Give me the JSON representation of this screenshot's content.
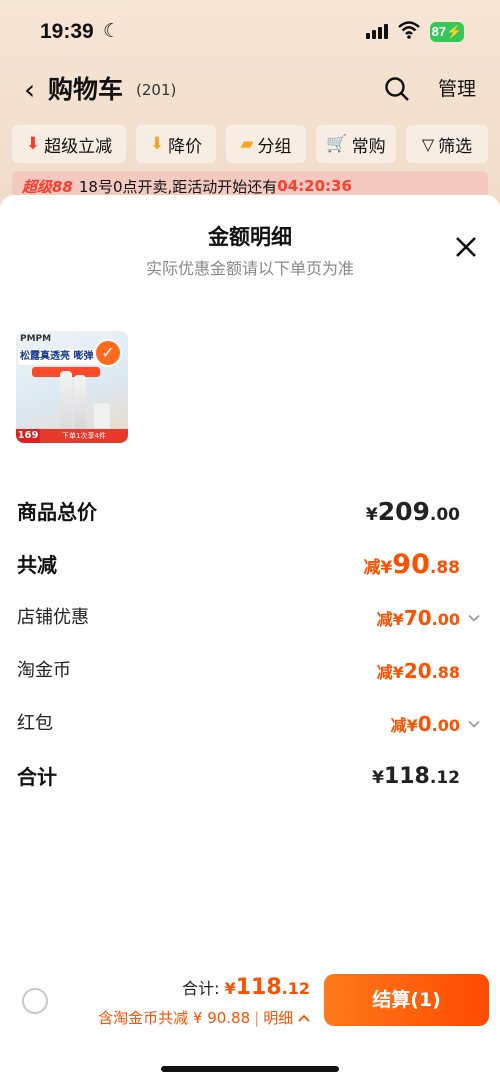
{
  "status_bar": {
    "time": "19:39",
    "battery": "87"
  },
  "nav": {
    "title": "购物车",
    "count": "(201)",
    "manage": "管理"
  },
  "filter_chips": [
    {
      "label": "超级立减",
      "icon": "down-arrow-icon"
    },
    {
      "label": "降价",
      "icon": "down-arrow-icon"
    },
    {
      "label": "分组",
      "icon": "folder-icon"
    },
    {
      "label": "常购",
      "icon": "cart-icon"
    },
    {
      "label": "筛选",
      "icon": "filter-icon"
    }
  ],
  "promo": {
    "logo": "超级88",
    "text": "18号0点开卖,距活动开始还有",
    "countdown": "04:20:36"
  },
  "sheet": {
    "title": "金额明细",
    "subtitle": "实际优惠金额请以下单页为准",
    "product": {
      "brand": "PMPM",
      "headline": "松露真透亮 嘭弹",
      "price": "169",
      "band": "下单1次享4件"
    },
    "rows": {
      "subtotal": {
        "label": "商品总价",
        "cur": "¥",
        "int": "209",
        "dec": ".00"
      },
      "total_discount": {
        "label": "共减",
        "cur": "减¥",
        "int": "90",
        "dec": ".88"
      },
      "shop_discount": {
        "label": "店铺优惠",
        "cur": "减¥",
        "int": "70",
        "dec": ".00"
      },
      "taojinbi": {
        "label": "淘金币",
        "cur": "减¥",
        "int": "20",
        "dec": ".88"
      },
      "red_packet": {
        "label": "红包",
        "cur": "减¥",
        "int": "0",
        "dec": ".00"
      },
      "total": {
        "label": "合计",
        "cur": "¥",
        "int": "118",
        "dec": ".12"
      }
    }
  },
  "footer": {
    "total_label": "合计: ",
    "total_cur": "¥",
    "total_int": "118",
    "total_dec": ".12",
    "discount_text": "含淘金币共减 ¥ 90.88",
    "separator": "|",
    "detail_label": "明细",
    "checkout_label": "结算(1)"
  },
  "colors": {
    "accent": "#ff5000",
    "button": "#ff6a1f",
    "battery": "#34c759"
  }
}
